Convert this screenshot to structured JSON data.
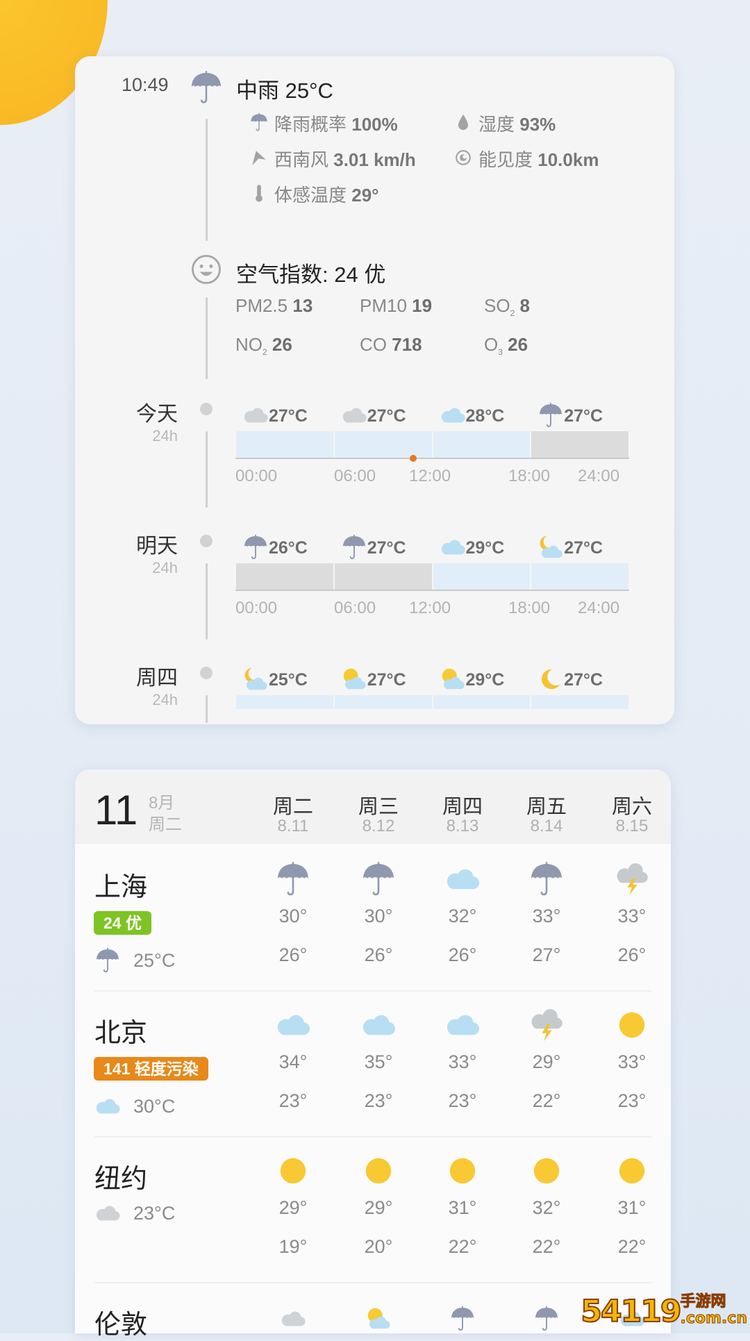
{
  "colors": {
    "rain_bar": "#dcdcdd",
    "clear_bar": "#e1eef9",
    "aqi_good": "#7ec423",
    "aqi_light": "#e8891a",
    "now_marker": "#e8791d",
    "sun": "#f9bd28"
  },
  "current": {
    "time": "10:49",
    "icon": "umbrella",
    "title": "中雨 25°C",
    "details": [
      {
        "icon": "umbrella-small",
        "label": "降雨概率",
        "value": "100%"
      },
      {
        "icon": "droplet",
        "label": "湿度",
        "value": "93%"
      },
      {
        "icon": "wind-arrow",
        "label": "西南风",
        "value": "3.01 km/h"
      },
      {
        "icon": "eye",
        "label": "能见度",
        "value": "10.0km"
      },
      {
        "icon": "thermometer",
        "label": "体感温度",
        "value": "29°"
      }
    ]
  },
  "air": {
    "icon": "smiley",
    "title": "空气指数: 24 优",
    "pollutants": [
      {
        "name": "PM2.5",
        "sub": "",
        "value": "13"
      },
      {
        "name": "PM10",
        "sub": "",
        "value": "19"
      },
      {
        "name": "SO",
        "sub": "2",
        "value": "8"
      },
      {
        "name": "NO",
        "sub": "2",
        "value": "26"
      },
      {
        "name": "CO",
        "sub": "",
        "value": "718"
      },
      {
        "name": "O",
        "sub": "3",
        "value": "26"
      }
    ]
  },
  "hourly": {
    "now_hour": 10.82,
    "ticks": [
      "00:00",
      "06:00",
      "12:00",
      "18:00",
      "24:00"
    ],
    "days": [
      {
        "label": "今天",
        "span": "24h",
        "periods": [
          {
            "icon": "cloud-gray",
            "temp": "27°C",
            "cond": "clear"
          },
          {
            "icon": "cloud-gray",
            "temp": "27°C",
            "cond": "clear"
          },
          {
            "icon": "cloud",
            "temp": "28°C",
            "cond": "clear"
          },
          {
            "icon": "umbrella",
            "temp": "27°C",
            "cond": "rain"
          }
        ]
      },
      {
        "label": "明天",
        "span": "24h",
        "periods": [
          {
            "icon": "umbrella",
            "temp": "26°C",
            "cond": "rain"
          },
          {
            "icon": "umbrella",
            "temp": "27°C",
            "cond": "rain"
          },
          {
            "icon": "cloud",
            "temp": "29°C",
            "cond": "clear"
          },
          {
            "icon": "partly-cloudy-night",
            "temp": "27°C",
            "cond": "clear"
          }
        ]
      },
      {
        "label": "周四",
        "span": "24h",
        "periods": [
          {
            "icon": "partly-cloudy-night",
            "temp": "25°C",
            "cond": "clear"
          },
          {
            "icon": "partly-cloudy-day",
            "temp": "27°C",
            "cond": "clear"
          },
          {
            "icon": "partly-cloudy-day",
            "temp": "29°C",
            "cond": "clear"
          },
          {
            "icon": "moon",
            "temp": "27°C",
            "cond": "clear"
          }
        ]
      }
    ]
  },
  "forecast": {
    "today_day": "11",
    "today_month": "8月",
    "today_weekday": "周二",
    "columns": [
      {
        "day": "周二",
        "date": "8.11"
      },
      {
        "day": "周三",
        "date": "8.12"
      },
      {
        "day": "周四",
        "date": "8.13"
      },
      {
        "day": "周五",
        "date": "8.14"
      },
      {
        "day": "周六",
        "date": "8.15"
      }
    ],
    "cities": [
      {
        "name": "上海",
        "aqi": "24 优",
        "aqi_level": "good",
        "cur_icon": "umbrella",
        "cur_temp": "25°C",
        "days": [
          {
            "icon": "umbrella",
            "high": "30°",
            "low": "26°"
          },
          {
            "icon": "umbrella",
            "high": "30°",
            "low": "26°"
          },
          {
            "icon": "cloud",
            "high": "32°",
            "low": "26°"
          },
          {
            "icon": "umbrella",
            "high": "33°",
            "low": "27°"
          },
          {
            "icon": "thunder",
            "high": "33°",
            "low": "26°"
          }
        ]
      },
      {
        "name": "北京",
        "aqi": "141 轻度污染",
        "aqi_level": "light",
        "cur_icon": "cloud",
        "cur_temp": "30°C",
        "days": [
          {
            "icon": "cloud",
            "high": "34°",
            "low": "23°"
          },
          {
            "icon": "cloud",
            "high": "35°",
            "low": "23°"
          },
          {
            "icon": "cloud",
            "high": "33°",
            "low": "23°"
          },
          {
            "icon": "thunder",
            "high": "29°",
            "low": "22°"
          },
          {
            "icon": "sun",
            "high": "33°",
            "low": "23°"
          }
        ]
      },
      {
        "name": "纽约",
        "aqi": "",
        "aqi_level": "",
        "cur_icon": "cloud-gray",
        "cur_temp": "23°C",
        "days": [
          {
            "icon": "sun",
            "high": "29°",
            "low": "19°"
          },
          {
            "icon": "sun",
            "high": "29°",
            "low": "20°"
          },
          {
            "icon": "sun",
            "high": "31°",
            "low": "22°"
          },
          {
            "icon": "sun",
            "high": "32°",
            "low": "22°"
          },
          {
            "icon": "sun",
            "high": "31°",
            "low": "22°"
          }
        ]
      },
      {
        "name": "伦敦",
        "aqi": "",
        "aqi_level": "",
        "cur_icon": "",
        "cur_temp": "",
        "days": [
          {
            "icon": "cloud-gray",
            "high": "",
            "low": ""
          },
          {
            "icon": "partly-cloudy-day",
            "high": "",
            "low": ""
          },
          {
            "icon": "umbrella",
            "high": "",
            "low": ""
          },
          {
            "icon": "umbrella",
            "high": "",
            "low": ""
          },
          {
            "icon": "cloud",
            "high": "",
            "low": ""
          }
        ]
      }
    ]
  },
  "watermark": {
    "number": "54119",
    "text": "手游网",
    "domain": ".com.cn"
  }
}
